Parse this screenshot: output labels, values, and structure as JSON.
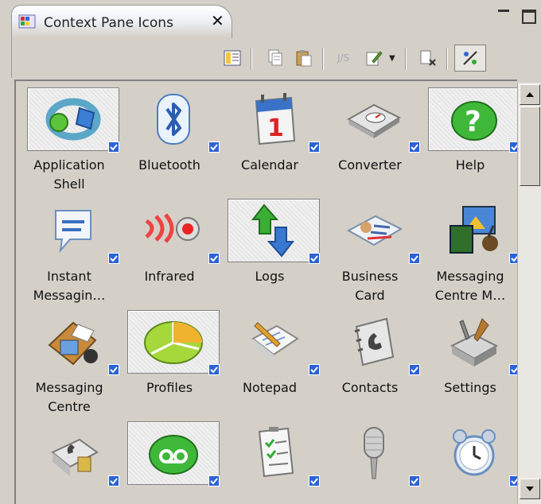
{
  "tab": {
    "title": "Context Pane Icons",
    "close": "✕"
  },
  "window_controls": {
    "minimize": "minimize-icon",
    "maximize": "maximize-icon"
  },
  "toolbar": {
    "buttons": [
      "layout-icon",
      "copy-icon",
      "paste-icon",
      "script-icon",
      "edit-icon",
      "dropdown-arrow-icon",
      "remove-icon",
      "toggle-icon"
    ]
  },
  "items": [
    {
      "label": "Application\nShell",
      "selected": true,
      "checked": true,
      "icon": "application-shell-icon"
    },
    {
      "label": "Bluetooth",
      "selected": false,
      "checked": true,
      "icon": "bluetooth-icon"
    },
    {
      "label": "Calendar",
      "selected": false,
      "checked": true,
      "icon": "calendar-icon"
    },
    {
      "label": "Converter",
      "selected": false,
      "checked": true,
      "icon": "converter-icon"
    },
    {
      "label": "Help",
      "selected": true,
      "checked": true,
      "icon": "help-icon"
    },
    {
      "label": "Instant\nMessagin…",
      "selected": false,
      "checked": true,
      "icon": "instant-messaging-icon"
    },
    {
      "label": "Infrared",
      "selected": false,
      "checked": true,
      "icon": "infrared-icon"
    },
    {
      "label": "Logs",
      "selected": true,
      "checked": true,
      "icon": "logs-icon"
    },
    {
      "label": "Business\nCard",
      "selected": false,
      "checked": true,
      "icon": "business-card-icon"
    },
    {
      "label": "Messaging\nCentre M…",
      "selected": false,
      "checked": true,
      "icon": "messaging-centre-mail-icon"
    },
    {
      "label": "Messaging\nCentre",
      "selected": false,
      "checked": true,
      "icon": "messaging-centre-icon"
    },
    {
      "label": "Profiles",
      "selected": true,
      "checked": true,
      "icon": "profiles-icon"
    },
    {
      "label": "Notepad",
      "selected": false,
      "checked": true,
      "icon": "notepad-icon"
    },
    {
      "label": "Contacts",
      "selected": false,
      "checked": true,
      "icon": "contacts-icon"
    },
    {
      "label": "Settings",
      "selected": false,
      "checked": true,
      "icon": "settings-icon"
    },
    {
      "label": "",
      "selected": false,
      "checked": true,
      "icon": "sim-contacts-icon"
    },
    {
      "label": "",
      "selected": true,
      "checked": true,
      "icon": "voicemail-icon"
    },
    {
      "label": "",
      "selected": false,
      "checked": true,
      "icon": "task-list-icon"
    },
    {
      "label": "",
      "selected": false,
      "checked": true,
      "icon": "microphone-icon"
    },
    {
      "label": "",
      "selected": false,
      "checked": true,
      "icon": "alarm-clock-icon"
    }
  ],
  "colors": {
    "check": "#2b63d6",
    "panel": "#d4d0c8"
  }
}
